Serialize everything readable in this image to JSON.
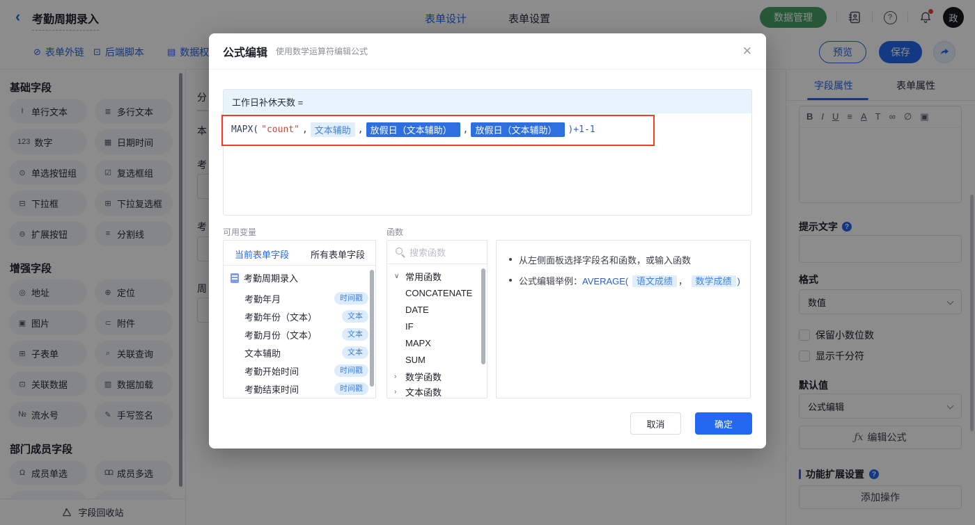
{
  "header": {
    "back": "‹",
    "title": "考勤周期录入",
    "tab_design": "表单设计",
    "tab_settings": "表单设置",
    "data_manage": "数据管理",
    "avatar": "政"
  },
  "toolbar": {
    "link_icon": "⊘",
    "link_label": "表单外链",
    "script_icon": "⊡",
    "script_label": "后端脚本",
    "perm_icon": "▤",
    "perm_label": "数据权",
    "preview": "预览",
    "save": "保存"
  },
  "sidebar": {
    "sections": [
      {
        "title": "基础字段",
        "items": [
          {
            "icon": "I",
            "label": "单行文本"
          },
          {
            "icon": "≣",
            "label": "多行文本"
          },
          {
            "icon": "123",
            "label": "数字"
          },
          {
            "icon": "▦",
            "label": "日期时间"
          },
          {
            "icon": "⊙",
            "label": "单选按钮组"
          },
          {
            "icon": "☑",
            "label": "复选框组"
          },
          {
            "icon": "⊟",
            "label": "下拉框"
          },
          {
            "icon": "⊞",
            "label": "下拉复选框"
          },
          {
            "icon": "⊖",
            "label": "扩展按钮"
          },
          {
            "icon": "≡",
            "label": "分割线"
          }
        ]
      },
      {
        "title": "增强字段",
        "items": [
          {
            "icon": "◎",
            "label": "地址"
          },
          {
            "icon": "⊕",
            "label": "定位"
          },
          {
            "icon": "▣",
            "label": "图片"
          },
          {
            "icon": "⊂",
            "label": "附件"
          },
          {
            "icon": "⊞",
            "label": "子表单"
          },
          {
            "icon": "⌕",
            "label": "关联查询"
          },
          {
            "icon": "⊡",
            "label": "关联数据"
          },
          {
            "icon": "▥",
            "label": "数据加载"
          },
          {
            "icon": "№",
            "label": "流水号"
          },
          {
            "icon": "✎",
            "label": "手写签名"
          }
        ]
      },
      {
        "title": "部门成员字段",
        "items": [
          {
            "icon": "Ω",
            "label": "成员单选"
          },
          {
            "icon": "ΩΩ",
            "label": "成员多选"
          }
        ]
      }
    ],
    "recycle": "字段回收站"
  },
  "canvas": {
    "fragments": [
      "分",
      "本",
      "考",
      "考",
      "周"
    ]
  },
  "modal": {
    "title": "公式编辑",
    "subtitle": "使用数学运算符编辑公式",
    "close": "✕",
    "formula": {
      "target": "工作日补休天数 =",
      "fn": "MAPX(",
      "str": "\"count\"",
      "comma": ",",
      "token1": "文本辅助",
      "token2": "放假日（文本辅助）",
      "token3": "放假日（文本辅助）",
      "tail": ")+1-1"
    },
    "variables": {
      "label": "可用变量",
      "tab_current": "当前表单字段",
      "tab_all": "所有表单字段",
      "root": "考勤周期录入",
      "fields": [
        {
          "name": "考勤年月",
          "type": "时间戳"
        },
        {
          "name": "考勤年份（文本）",
          "type": "文本"
        },
        {
          "name": "考勤月份（文本）",
          "type": "文本"
        },
        {
          "name": "文本辅助",
          "type": "文本"
        },
        {
          "name": "考勤开始时间",
          "type": "时间戳"
        },
        {
          "name": "考勤结束时间",
          "type": "时间戳"
        }
      ]
    },
    "functions": {
      "label": "函数",
      "search_placeholder": "搜索函数",
      "group_common": "常用函数",
      "items": [
        "CONCATENATE",
        "DATE",
        "IF",
        "MAPX",
        "SUM"
      ],
      "group_math": "数学函数",
      "group_text": "文本函数",
      "chev_open": "∨",
      "chev_closed": "›"
    },
    "tips": {
      "line1": "从左侧面板选择字段名和函数，或输入函数",
      "line2_label": "公式编辑举例：",
      "fn": "AVERAGE(",
      "token1": "语文成绩",
      "sep": "，",
      "token2": "数学成绩",
      "tail": ")"
    },
    "cancel": "取消",
    "ok": "确定"
  },
  "properties": {
    "tab_field": "字段属性",
    "tab_form": "表单属性",
    "richbar": [
      "B",
      "I",
      "U",
      "≡",
      "A",
      "T",
      "∞",
      "∅",
      "▣"
    ],
    "hint_label": "提示文字",
    "format_label": "格式",
    "format_value": "数值",
    "cb1": "保留小数位数",
    "cb2": "显示千分符",
    "default_label": "默认值",
    "default_value": "公式编辑",
    "fx": "ƒx",
    "edit_formula": "编辑公式",
    "ext_label": "功能扩展设置",
    "add_action": "添加操作"
  },
  "colors": {
    "primary": "#2468f2",
    "green": "#45a065",
    "annotation_red": "#f5392c",
    "token_blue": "#2e6fe0",
    "token_light_bg": "#e0edfb"
  }
}
